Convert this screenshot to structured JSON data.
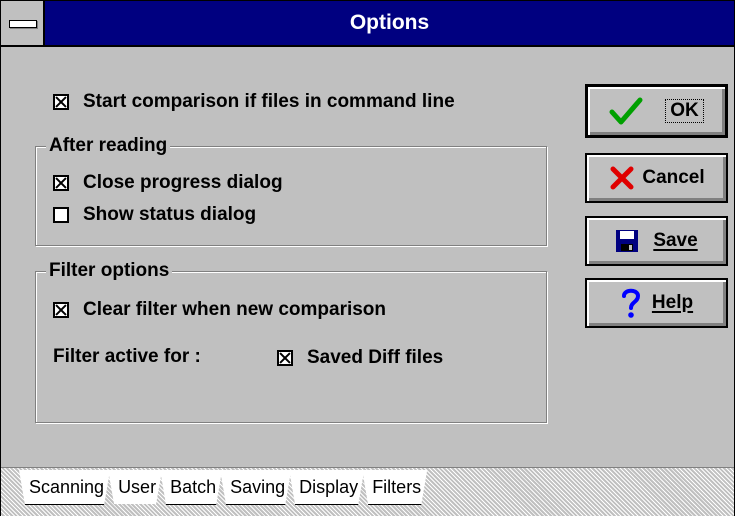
{
  "window": {
    "title": "Options"
  },
  "options": {
    "start_comparison": {
      "label": "Start comparison if files in command line",
      "checked": true
    }
  },
  "after_reading": {
    "legend": "After reading",
    "close_progress": {
      "label": "Close progress dialog",
      "checked": true
    },
    "show_status": {
      "label": "Show status dialog",
      "checked": false
    }
  },
  "filter_options": {
    "legend": "Filter options",
    "clear_filter": {
      "label": "Clear filter when new comparison",
      "checked": true
    },
    "filter_active_label": "Filter active for :",
    "saved_diff": {
      "label": "Saved Diff files",
      "checked": true
    }
  },
  "buttons": {
    "ok": {
      "label": "OK",
      "icon": "check-icon",
      "color": "#00a000"
    },
    "cancel": {
      "label": "Cancel",
      "icon": "x-icon",
      "color": "#e00000"
    },
    "save": {
      "label": "Save",
      "icon": "floppy-disk-icon",
      "color": "#000080"
    },
    "help": {
      "label": "Help",
      "icon": "question-mark-icon",
      "color": "#0000ff"
    }
  },
  "tabs": [
    "Scanning",
    "User",
    "Batch",
    "Saving",
    "Display",
    "Filters"
  ],
  "active_tab": "User"
}
